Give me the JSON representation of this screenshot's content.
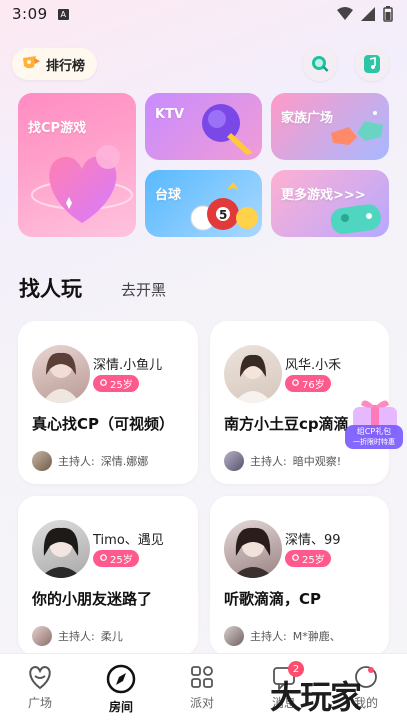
{
  "status_bar": {
    "time": "3:09",
    "indicator": "A"
  },
  "header": {
    "rank_label": "排行榜",
    "search_icon": "search-icon",
    "note_icon": "music-note-icon"
  },
  "features": {
    "cp": "找CP游戏",
    "ktv": "KTV",
    "family": "家族广场",
    "billiards": "台球",
    "more": "更多游戏>>>"
  },
  "section": {
    "tab_active": "找人玩",
    "tab_other": "去开黑"
  },
  "cards": [
    {
      "name": "深情.小鱼儿",
      "age": "25岁",
      "title": "真心找CP（可视频）",
      "host_prefix": "主持人:",
      "host": "深情.娜娜"
    },
    {
      "name": "风华.小禾",
      "age": "76岁",
      "title": "南方小土豆cp滴滴",
      "host_prefix": "主持人:",
      "host": "暗中观察!"
    },
    {
      "name": "Timo、遇见",
      "age": "25岁",
      "title": "你的小朋友迷路了",
      "host_prefix": "主持人:",
      "host": "柔儿"
    },
    {
      "name": "深情、99",
      "age": "25岁",
      "title": "听歌滴滴，CP",
      "host_prefix": "主持人:",
      "host": "M*翀鹿、"
    }
  ],
  "gift": {
    "line1": "组CP礼包",
    "line2": "一折限时特惠"
  },
  "nav": [
    {
      "label": "广场",
      "icon": "heart-icon"
    },
    {
      "label": "房间",
      "icon": "compass-icon"
    },
    {
      "label": "派对",
      "icon": "apps-icon"
    },
    {
      "label": "消息",
      "icon": "message-icon",
      "badge": "2"
    },
    {
      "label": "我的",
      "icon": "profile-icon"
    }
  ],
  "watermark": "大玩家",
  "colors": {
    "accent_pink": "#ff5a8d",
    "badge_red": "#ff4d6d"
  }
}
